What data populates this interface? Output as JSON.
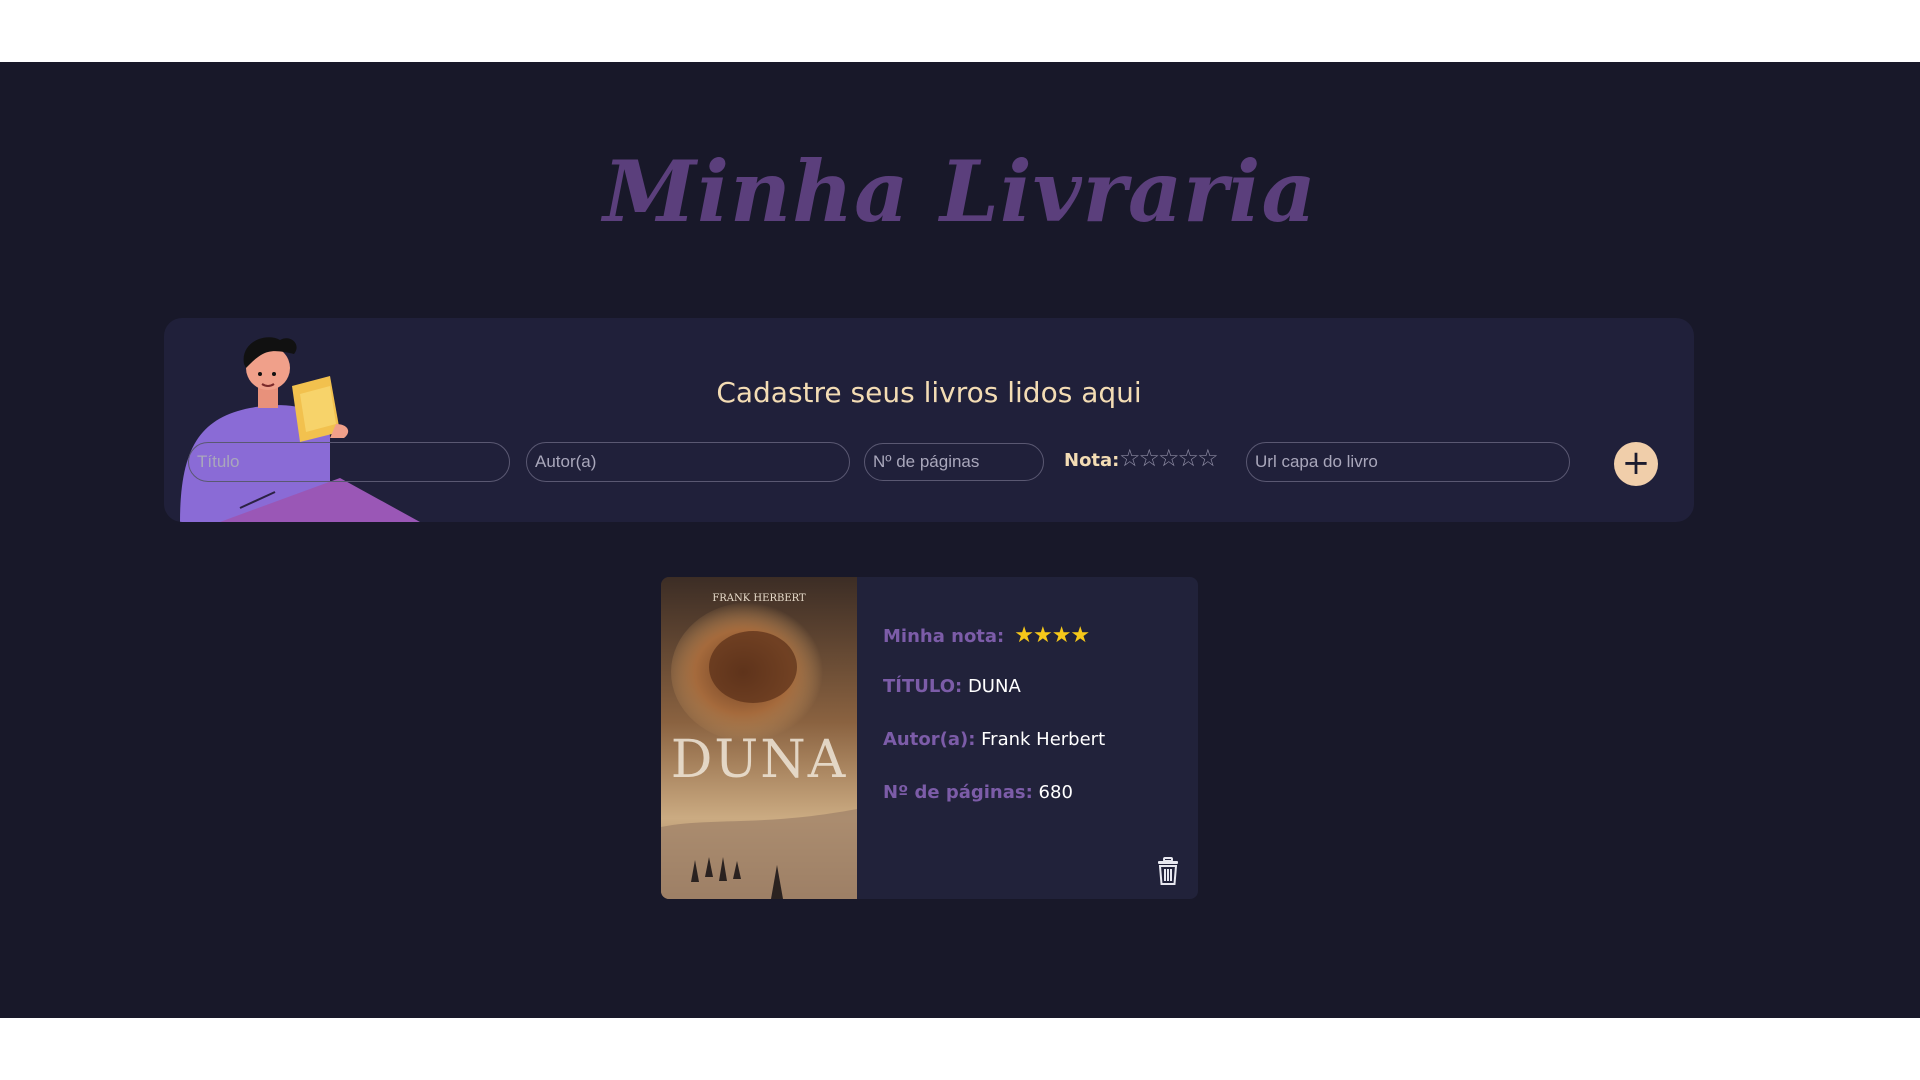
{
  "app": {
    "title": "Minha Livraria"
  },
  "form": {
    "heading": "Cadastre seus livros lidos aqui",
    "title_placeholder": "Título",
    "author_placeholder": "Autor(a)",
    "pages_placeholder": "Nº de páginas",
    "rating_label": "Nota:",
    "rating_stars": "☆☆☆☆☆",
    "rating_value": 0,
    "url_placeholder": "Url capa do livro",
    "add_button_label": "+",
    "add_icon": "plus-icon",
    "illustration": "person-reading-illustration"
  },
  "books": [
    {
      "rating_label": "Minha nota:",
      "rating_stars": "★★★★",
      "rating_value": 4,
      "title_label": "TÍTULO:",
      "title": "DUNA",
      "author_label": "Autor(a):",
      "author": "Frank Herbert",
      "pages_label": "Nº de páginas:",
      "pages": "680",
      "cover_author_text": "FRANK HERBERT",
      "cover_title_text": "DUNA",
      "delete_icon": "trash-icon"
    }
  ],
  "colors": {
    "background": "#181829",
    "panel": "#20203a",
    "card": "#21223a",
    "title": "#5b3f7c",
    "accent": "#f0ceaa",
    "label": "#7c5ca8",
    "star": "#f6c81a"
  }
}
